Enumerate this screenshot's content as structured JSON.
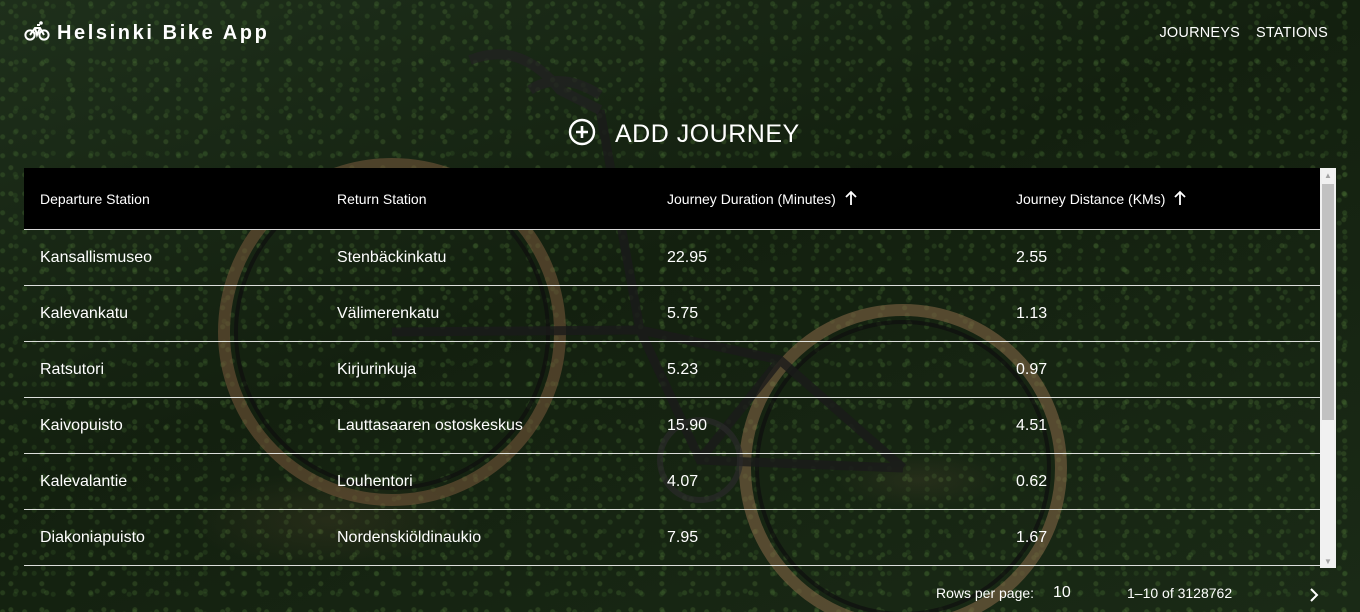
{
  "app": {
    "title": "Helsinki Bike App",
    "logo_icon": "bicycle-icon"
  },
  "nav": {
    "journeys": "JOURNEYS",
    "stations": "STATIONS"
  },
  "add_journey": {
    "label": "ADD JOURNEY",
    "icon": "add-circle-icon"
  },
  "table": {
    "headers": {
      "departure": "Departure Station",
      "return": "Return Station",
      "duration": "Journey Duration (Minutes)",
      "distance": "Journey Distance (KMs)"
    },
    "sort_icon": "arrow-up-icon",
    "rows": [
      {
        "departure": "Kansallismuseo",
        "return": "Stenbäckinkatu",
        "duration": "22.95",
        "distance": "2.55"
      },
      {
        "departure": "Kalevankatu",
        "return": "Välimerenkatu",
        "duration": "5.75",
        "distance": "1.13"
      },
      {
        "departure": "Ratsutori",
        "return": "Kirjurinkuja",
        "duration": "5.23",
        "distance": "0.97"
      },
      {
        "departure": "Kaivopuisto",
        "return": "Lauttasaaren ostoskeskus",
        "duration": "15.90",
        "distance": "4.51"
      },
      {
        "departure": "Kalevalantie",
        "return": "Louhentori",
        "duration": "4.07",
        "distance": "0.62"
      },
      {
        "departure": "Diakoniapuisto",
        "return": "Nordenskiöldinaukio",
        "duration": "7.95",
        "distance": "1.67"
      }
    ]
  },
  "pagination": {
    "rows_per_page_label": "Rows per page:",
    "rows_per_page_value": "10",
    "range": "1–10 of 3128762",
    "next_icon": "chevron-right-icon"
  },
  "colors": {
    "table_header_bg": "#000000",
    "text": "#ffffff",
    "scrollbar_track": "#f1f1f1",
    "scrollbar_thumb": "#c1c1c1"
  }
}
